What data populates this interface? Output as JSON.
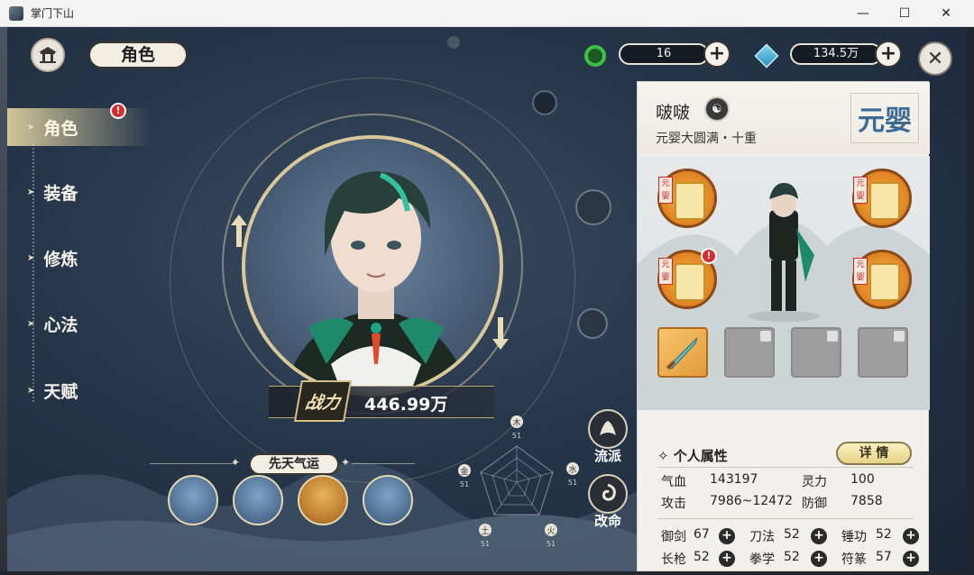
{
  "window": {
    "title": "掌门下山"
  },
  "header": {
    "title": "角色",
    "resource1": {
      "value": "16",
      "icon": "jade-ring-icon"
    },
    "resource2": {
      "value": "134.5万",
      "icon": "spirit-crystal-icon"
    }
  },
  "nav": {
    "items": [
      {
        "label": "角色",
        "active": true,
        "alert": "!"
      },
      {
        "label": "装备"
      },
      {
        "label": "修炼"
      },
      {
        "label": "心法"
      },
      {
        "label": "天赋"
      }
    ]
  },
  "portrait": {
    "power_label": "战力",
    "power_value": "446.99万"
  },
  "fortune": {
    "title": "先天气运"
  },
  "radar": {
    "axes": [
      {
        "name": "木",
        "value": "51"
      },
      {
        "name": "水",
        "value": "51"
      },
      {
        "name": "火",
        "value": "51"
      },
      {
        "name": "土",
        "value": "51"
      },
      {
        "name": "金",
        "value": "51"
      }
    ]
  },
  "side": {
    "faction": "流派",
    "fate": "改命"
  },
  "panel": {
    "name": "啵啵",
    "realm": "元婴大圆满・十重",
    "realm_seal": "元婴",
    "equip_tag": "元婴",
    "equip_alert": "!",
    "attr_title": "个人属性",
    "detail_button": "详 情",
    "attributes": [
      {
        "label": "气血",
        "value": "143197"
      },
      {
        "label": "灵力",
        "value": "100"
      },
      {
        "label": "攻击",
        "value": "7986~12472"
      },
      {
        "label": "防御",
        "value": "7858"
      }
    ],
    "skills": [
      {
        "label": "御剑",
        "value": "67"
      },
      {
        "label": "刀法",
        "value": "52"
      },
      {
        "label": "锤功",
        "value": "52"
      },
      {
        "label": "长枪",
        "value": "52"
      },
      {
        "label": "拳学",
        "value": "52"
      },
      {
        "label": "符篆",
        "value": "57"
      }
    ]
  },
  "colors": {
    "accent": "#d9c89a",
    "panel_bg": "#f2f0ec",
    "alert": "#d92c2c"
  }
}
